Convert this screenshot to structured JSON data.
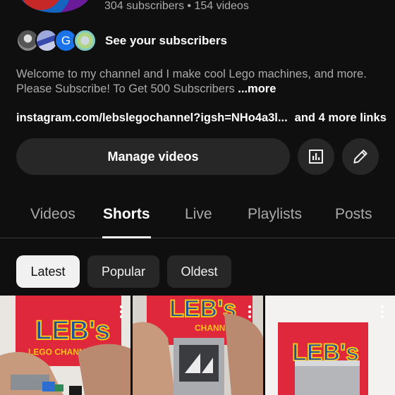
{
  "channel": {
    "stats": "304 subscribers • 154 videos",
    "see_subscribers_label": "See your subscribers",
    "subscriber_avatar_initial": "G",
    "description": "Welcome to my channel and I make cool Lego machines, and more. Please Subscribe! To Get 500 Subscribers",
    "description_more": "...more",
    "link": "instagram.com/lebslegochannel?igsh=NHo4a3l...",
    "more_links": "and 4 more links"
  },
  "actions": {
    "manage_videos_label": "Manage videos",
    "analytics_icon": "analytics-icon",
    "edit_icon": "pencil-icon"
  },
  "tabs": [
    {
      "label": "Videos",
      "active": false
    },
    {
      "label": "Shorts",
      "active": true
    },
    {
      "label": "Live",
      "active": false
    },
    {
      "label": "Playlists",
      "active": false
    },
    {
      "label": "Posts",
      "active": false
    }
  ],
  "filters": [
    {
      "label": "Latest",
      "selected": true
    },
    {
      "label": "Popular",
      "selected": false
    },
    {
      "label": "Oldest",
      "selected": false
    }
  ],
  "shorts": [
    {
      "logo_text": "LEB's",
      "logo_subtext": "LEGO CHANNEL"
    },
    {
      "logo_text": "LEB's",
      "logo_subtext": "CHANNEL"
    },
    {
      "logo_text": "LEB's",
      "logo_subtext": ""
    }
  ],
  "colors": {
    "background": "#0f0f0f",
    "surface": "#272727",
    "text_primary": "#f1f1f1",
    "text_secondary": "#aaaaaa",
    "brand_red": "#e0283c",
    "logo_yellow": "#f5c518",
    "logo_blue": "#1e4fa3"
  }
}
